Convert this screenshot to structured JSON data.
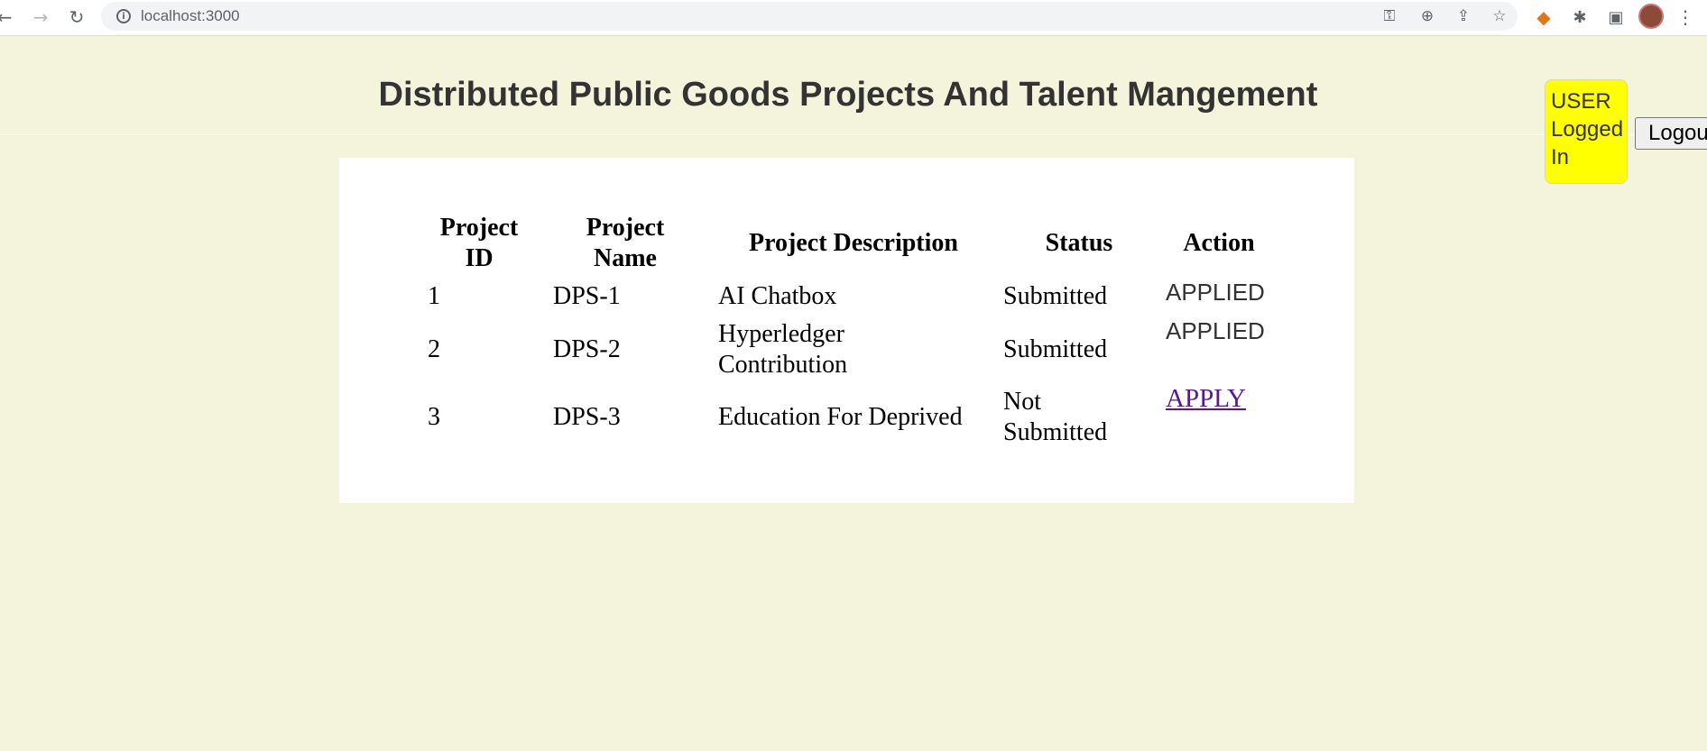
{
  "browser": {
    "url": "localhost:3000",
    "icons": [
      "back-arrow-icon",
      "forward-arrow-icon",
      "reload-icon",
      "site-info-icon",
      "key-icon",
      "zoom-icon",
      "share-icon",
      "bookmark-star-icon",
      "metamask-fox-icon",
      "extensions-puzzle-icon",
      "side-panel-icon",
      "profile-avatar-icon",
      "menu-dots-icon"
    ]
  },
  "page": {
    "title": "Distributed Public Goods Projects And Talent Mangement",
    "login_status": "USER Logged In",
    "logout_label": "Logout"
  },
  "table": {
    "headers": {
      "id": "Project ID",
      "name": "Project Name",
      "description": "Project Description",
      "status": "Status",
      "action": "Action"
    },
    "rows": [
      {
        "id": "1",
        "name": "DPS-1",
        "description": "AI Chatbox",
        "status": "Submitted",
        "action": "APPLIED"
      },
      {
        "id": "2",
        "name": "DPS-2",
        "description": "Hyperledger Contribution",
        "status": "Submitted",
        "action": "APPLIED"
      },
      {
        "id": "3",
        "name": "DPS-3",
        "description": "Education For Deprived",
        "status": "Not Submitted",
        "action": "APPLY"
      }
    ]
  },
  "colors": {
    "background": "#f4f4dc",
    "badge": "#ffff00",
    "link": "#551a8b"
  }
}
